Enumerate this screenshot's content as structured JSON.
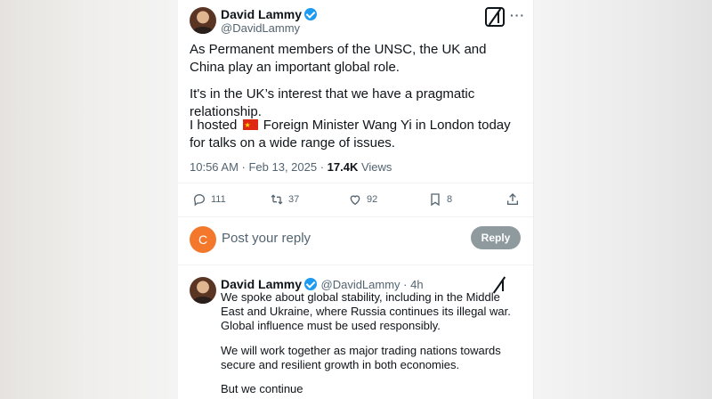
{
  "tweet": {
    "author_name": "David Lammy",
    "author_handle": "@DavidLammy",
    "para1": "As Permanent members of the UNSC, the UK and China play an important global role.",
    "para2": "It's in the UK’s interest that we have a pragmatic relationship.",
    "para3_prefix": "I hosted",
    "flag_icon": "china-flag-icon",
    "para3_rest": " Foreign Minister Wang Yi in London today for talks on a wide range of issues.",
    "timestamp": "10:56 AM · Feb 13, 2025 · ",
    "views_count": "17.4K",
    "views_label": " Views",
    "more": "···"
  },
  "actions": {
    "replies": "111",
    "reposts": "37",
    "likes": "92",
    "bookmarks": "8"
  },
  "composer": {
    "avatar_letter": "C",
    "placeholder": "Post your reply",
    "button": "Reply"
  },
  "reply": {
    "author_name": "David Lammy",
    "author_handle": "@DavidLammy",
    "time": " · 4h",
    "para1": "We spoke about global stability, including in the Middle East and Ukraine, where Russia continues its illegal war. Global influence must be used responsibly.",
    "para2": "We will work together as major trading nations towards secure and resilient growth in both economies.",
    "para3": "But we continue"
  },
  "colors": {
    "accent": "#1d9bf0",
    "composer_avatar": "#f4782c",
    "reply_button": "#8f9a9f"
  }
}
